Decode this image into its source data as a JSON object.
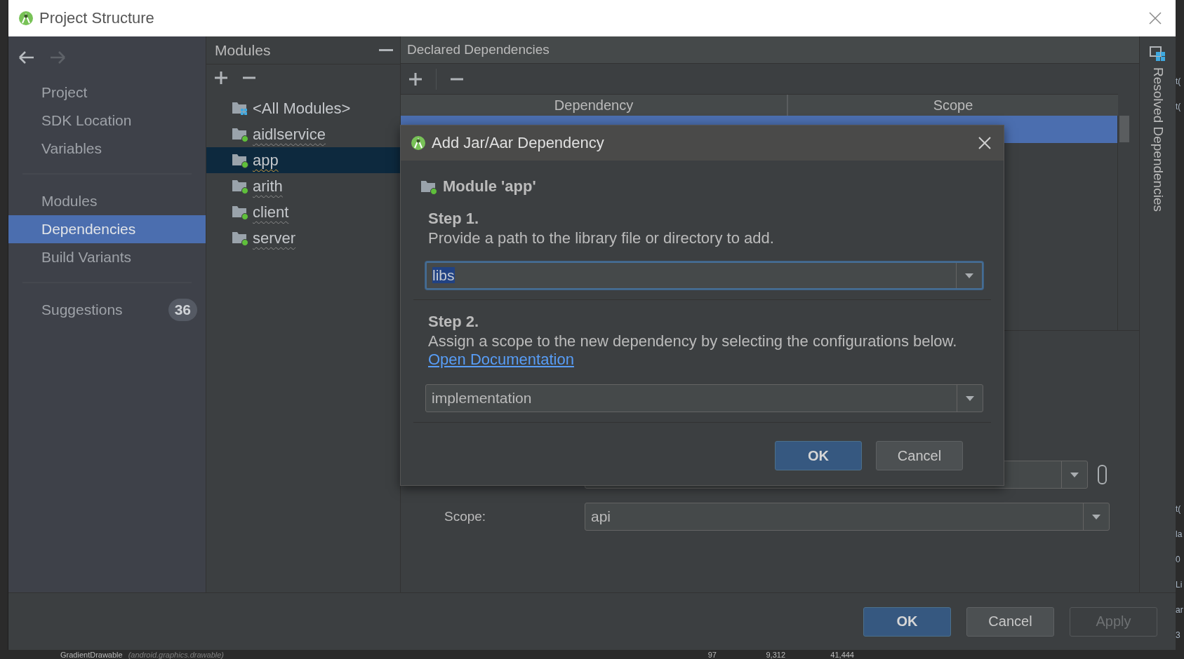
{
  "window": {
    "title": "Project Structure"
  },
  "sidebar": {
    "groups": [
      {
        "items": [
          {
            "label": "Project",
            "selected": false
          },
          {
            "label": "SDK Location",
            "selected": false
          },
          {
            "label": "Variables",
            "selected": false
          }
        ]
      },
      {
        "items": [
          {
            "label": "Modules",
            "selected": false
          },
          {
            "label": "Dependencies",
            "selected": true
          },
          {
            "label": "Build Variants",
            "selected": false
          }
        ]
      },
      {
        "items": [
          {
            "label": "Suggestions",
            "selected": false,
            "badge": "36"
          }
        ]
      }
    ]
  },
  "modules": {
    "title": "Modules",
    "items": [
      {
        "label": "<All Modules>",
        "kind": "all",
        "selected": false
      },
      {
        "label": "aidlservice",
        "kind": "module",
        "selected": false
      },
      {
        "label": "app",
        "kind": "module",
        "selected": true
      },
      {
        "label": "arith",
        "kind": "module",
        "selected": false
      },
      {
        "label": "client",
        "kind": "module",
        "selected": false
      },
      {
        "label": "server",
        "kind": "module",
        "selected": false
      }
    ]
  },
  "declared": {
    "title": "Declared Dependencies",
    "columns": [
      "Dependency",
      "Scope"
    ],
    "rows": [
      {
        "selected": true
      }
    ],
    "scope_label": "Scope:",
    "scope_value": "api"
  },
  "resolved_tab": {
    "label": "Resolved Dependencies"
  },
  "buttons": [
    {
      "label": "OK",
      "kind": "primary",
      "disabled": false
    },
    {
      "label": "Cancel",
      "kind": "normal",
      "disabled": false
    },
    {
      "label": "Apply",
      "kind": "normal",
      "disabled": true
    }
  ],
  "dialog": {
    "title": "Add Jar/Aar Dependency",
    "module": "Module 'app'",
    "steps": [
      {
        "title": "Step 1.",
        "text": "Provide a path to the library file or directory to add.",
        "field": {
          "value": "libs",
          "focused": true,
          "text_selected": true
        }
      },
      {
        "title": "Step 2.",
        "text": "Assign a scope to the new dependency by selecting the configurations below.",
        "link": "Open Documentation",
        "field": {
          "value": "implementation",
          "focused": false,
          "text_selected": false
        }
      }
    ],
    "buttons": [
      {
        "label": "OK",
        "kind": "primary",
        "disabled": false
      },
      {
        "label": "Cancel",
        "kind": "normal",
        "disabled": false
      }
    ]
  },
  "background": {
    "row": [
      "GradientDrawable",
      "(android.graphics.drawable)",
      "97",
      "9,312",
      "41,444"
    ],
    "edge_fragments": [
      "t(",
      "t(",
      "t(",
      "la",
      "0",
      "Li",
      "ar",
      "3"
    ]
  }
}
